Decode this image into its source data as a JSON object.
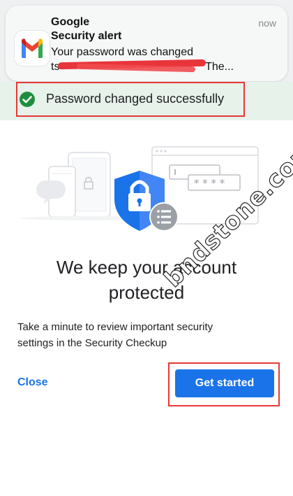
{
  "notification": {
    "app": "Google",
    "time": "now",
    "title": "Security alert",
    "body_line1": "Your password was changed",
    "body_line2": "ts                                               The...",
    "icon": "gmail-icon"
  },
  "success": {
    "message": "Password changed successfully",
    "icon": "check-circle-icon",
    "color": "#1e8e3e"
  },
  "main": {
    "heading_line1": "We keep your account",
    "heading_line2": "protected",
    "description": "Take a minute to review important security settings in the Security Checkup"
  },
  "actions": {
    "close_label": "Close",
    "get_started_label": "Get started",
    "accent": "#1a73e8"
  },
  "watermark": {
    "text": "bndstone.com"
  },
  "colors": {
    "highlight": "#e53935",
    "success_bg": "#e6f2ea"
  }
}
